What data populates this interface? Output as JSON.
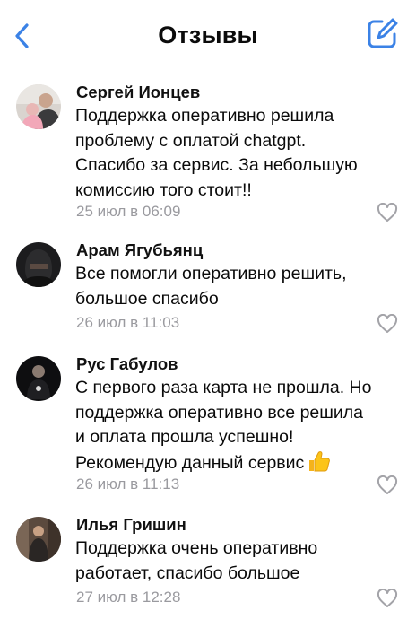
{
  "header": {
    "title": "Отзывы",
    "back_icon": "chevron-left-icon",
    "edit_icon": "compose-icon",
    "accent_color": "#3b82e6"
  },
  "reviews": [
    {
      "author": "Сергей Ионцев",
      "lines": [
        "Поддержка оперативно решила",
        "проблему с оплатой chatgpt.",
        "Спасибо за сервис. За небольшую",
        "комиссию того стоит!!"
      ],
      "date": "25 июл в 06:09"
    },
    {
      "author": "Арам Ягубьянц",
      "lines": [
        "Все помогли оперативно решить,",
        "большое спасибо"
      ],
      "date": "26 июл в 11:03"
    },
    {
      "author": "Рус Габулов",
      "lines": [
        "С первого раза карта не прошла. Но",
        "поддержка оперативно все решила",
        "и оплата прошла успешно!",
        "Рекомендую данный сервис"
      ],
      "emoji": "thumbs-up-icon",
      "date": "26 июл в 11:13"
    },
    {
      "author": "Илья Гришин",
      "lines": [
        "Поддержка очень оперативно",
        "работает, спасибо большое"
      ],
      "date": "27 июл в 12:28"
    }
  ]
}
